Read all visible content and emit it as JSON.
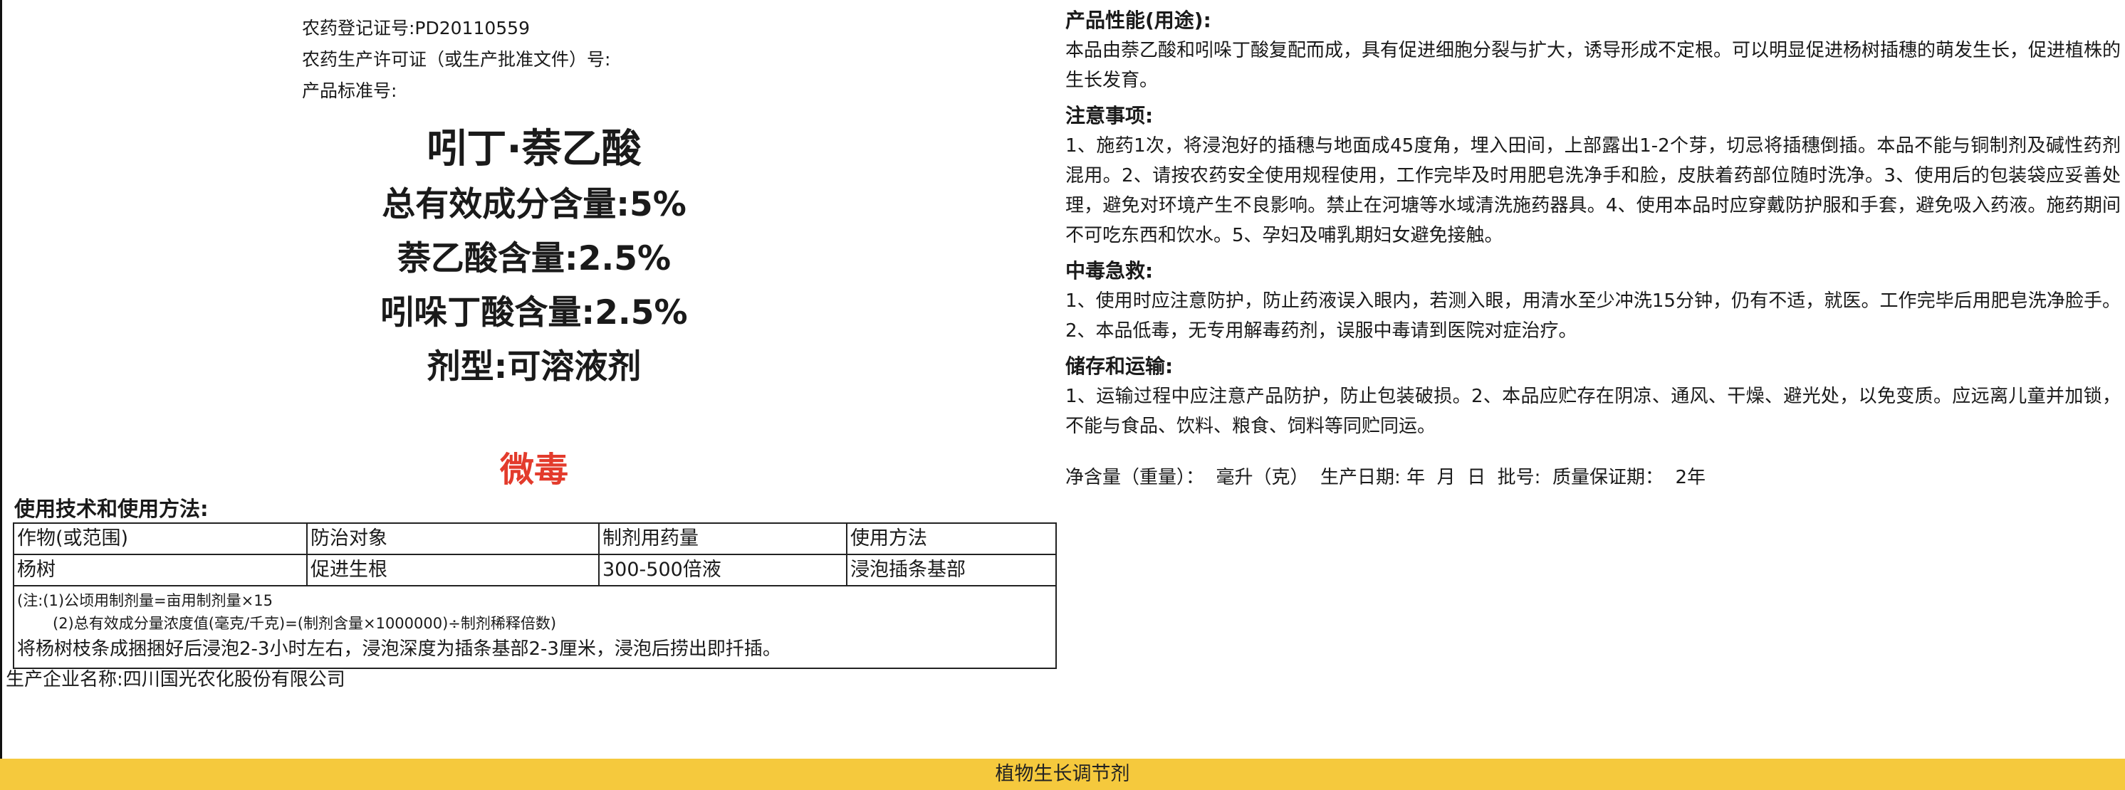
{
  "registration": {
    "reg_number": "农药登记证号:PD20110559",
    "production_license": "农药生产许可证（或生产批准文件）号:",
    "product_standard": "产品标准号:"
  },
  "product": {
    "name": "吲丁·萘乙酸",
    "total_active": "总有效成分含量:5%",
    "naa_content": "萘乙酸含量:2.5%",
    "iba_content": "吲哚丁酸含量:2.5%",
    "formulation": "剂型:可溶液剂",
    "toxicity": "微毒",
    "toxicity_color": "#e33b2c"
  },
  "usage": {
    "title": "使用技术和使用方法:",
    "headers": [
      "作物(或范围)",
      "防治对象",
      "制剂用药量",
      "使用方法"
    ],
    "rows": [
      [
        "杨树",
        "促进生根",
        "300-500倍液",
        "浸泡插条基部"
      ]
    ],
    "note1": "(注:(1)公顷用制剂量=亩用制剂量×15",
    "note2": "(2)总有效成分量浓度值(毫克/千克)=(制剂含量×1000000)÷制剂稀释倍数)",
    "note3": "将杨树枝条成捆捆好后浸泡2-3小时左右，浸泡深度为插条基部2-3厘米，浸泡后捞出即扦插。"
  },
  "manufacturer": "生产企业名称:四川国光农化股份有限公司",
  "sections": [
    {
      "title": "产品性能(用途):",
      "body": "本品由萘乙酸和吲哚丁酸复配而成，具有促进细胞分裂与扩大，诱导形成不定根。可以明显促进杨树插穗的萌发生长，促进植株的生长发育。"
    },
    {
      "title": "注意事项:",
      "body": "1、施药1次，将浸泡好的插穗与地面成45度角，埋入田间，上部露出1-2个芽，切忌将插穗倒插。本品不能与铜制剂及碱性药剂混用。2、请按农药安全使用规程使用，工作完毕及时用肥皂洗净手和脸，皮肤着药部位随时洗净。3、使用后的包装袋应妥善处理，避免对环境产生不良影响。禁止在河塘等水域清洗施药器具。4、使用本品时应穿戴防护服和手套，避免吸入药液。施药期间不可吃东西和饮水。5、孕妇及哺乳期妇女避免接触。"
    },
    {
      "title": "中毒急救:",
      "body": "1、使用时应注意防护，防止药液误入眼内，若测入眼，用清水至少冲洗15分钟，仍有不适，就医。工作完毕后用肥皂洗净脸手。2、本品低毒，无专用解毒药剂，误服中毒请到医院对症治疗。"
    },
    {
      "title": "储存和运输:",
      "body": "1、运输过程中应注意产品防护，防止包装破损。2、本品应贮存在阴凉、通风、干燥、避光处，以免变质。应远离儿童并加锁，不能与食品、饮料、粮食、饲料等同贮同运。"
    }
  ],
  "net_content": "净含量（重量）：  毫升（克）  生产日期: 年  月  日  批号:  质量保证期：  2年",
  "footer": {
    "category": "植物生长调节剂",
    "color": "#f5c93d"
  }
}
